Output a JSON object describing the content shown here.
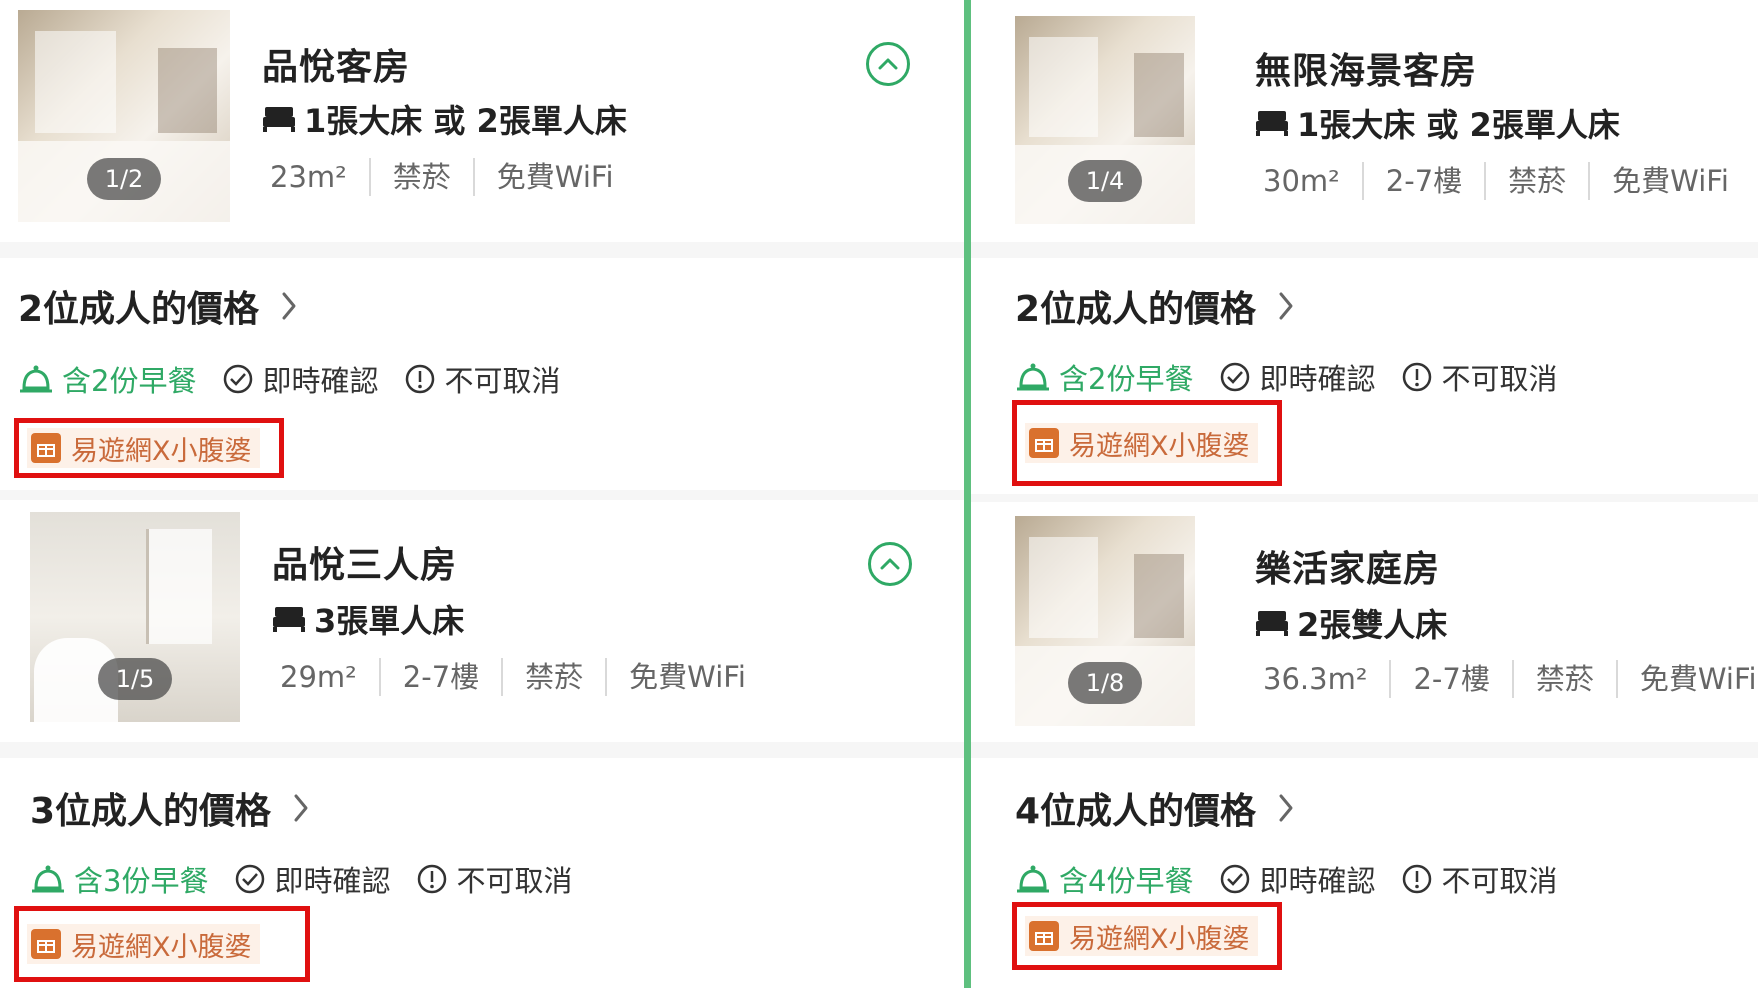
{
  "colors": {
    "accent_green": "#2fa965",
    "divider_green": "#5ec07f",
    "promo_red_box": "#e01010",
    "promo_text": "#c96a3b",
    "promo_bg": "#fdf1e8"
  },
  "left": {
    "rooms": [
      {
        "name": "品悅客房",
        "bed": "1張大床 或 2張單人床",
        "specs": [
          "23m²",
          "禁菸",
          "免費WiFi"
        ],
        "photo_counter": "1/2",
        "price_title": "2位成人的價格",
        "breakfast": "含2份早餐",
        "confirm": "即時確認",
        "cancel": "不可取消",
        "promo": "易遊網X小腹婆"
      },
      {
        "name": "品悅三人房",
        "bed": "3張單人床",
        "specs": [
          "29m²",
          "2-7樓",
          "禁菸",
          "免費WiFi"
        ],
        "photo_counter": "1/5",
        "price_title": "3位成人的價格",
        "breakfast": "含3份早餐",
        "confirm": "即時確認",
        "cancel": "不可取消",
        "promo": "易遊網X小腹婆"
      }
    ]
  },
  "right": {
    "rooms": [
      {
        "name": "無限海景客房",
        "bed": "1張大床 或 2張單人床",
        "specs": [
          "30m²",
          "2-7樓",
          "禁菸",
          "免費WiFi"
        ],
        "photo_counter": "1/4",
        "price_title": "2位成人的價格",
        "breakfast": "含2份早餐",
        "confirm": "即時確認",
        "cancel": "不可取消",
        "promo": "易遊網X小腹婆"
      },
      {
        "name": "樂活家庭房",
        "bed": "2張雙人床",
        "specs": [
          "36.3m²",
          "2-7樓",
          "禁菸",
          "免費WiFi"
        ],
        "photo_counter": "1/8",
        "price_title": "4位成人的價格",
        "breakfast": "含4份早餐",
        "confirm": "即時確認",
        "cancel": "不可取消",
        "promo": "易遊網X小腹婆"
      }
    ]
  }
}
